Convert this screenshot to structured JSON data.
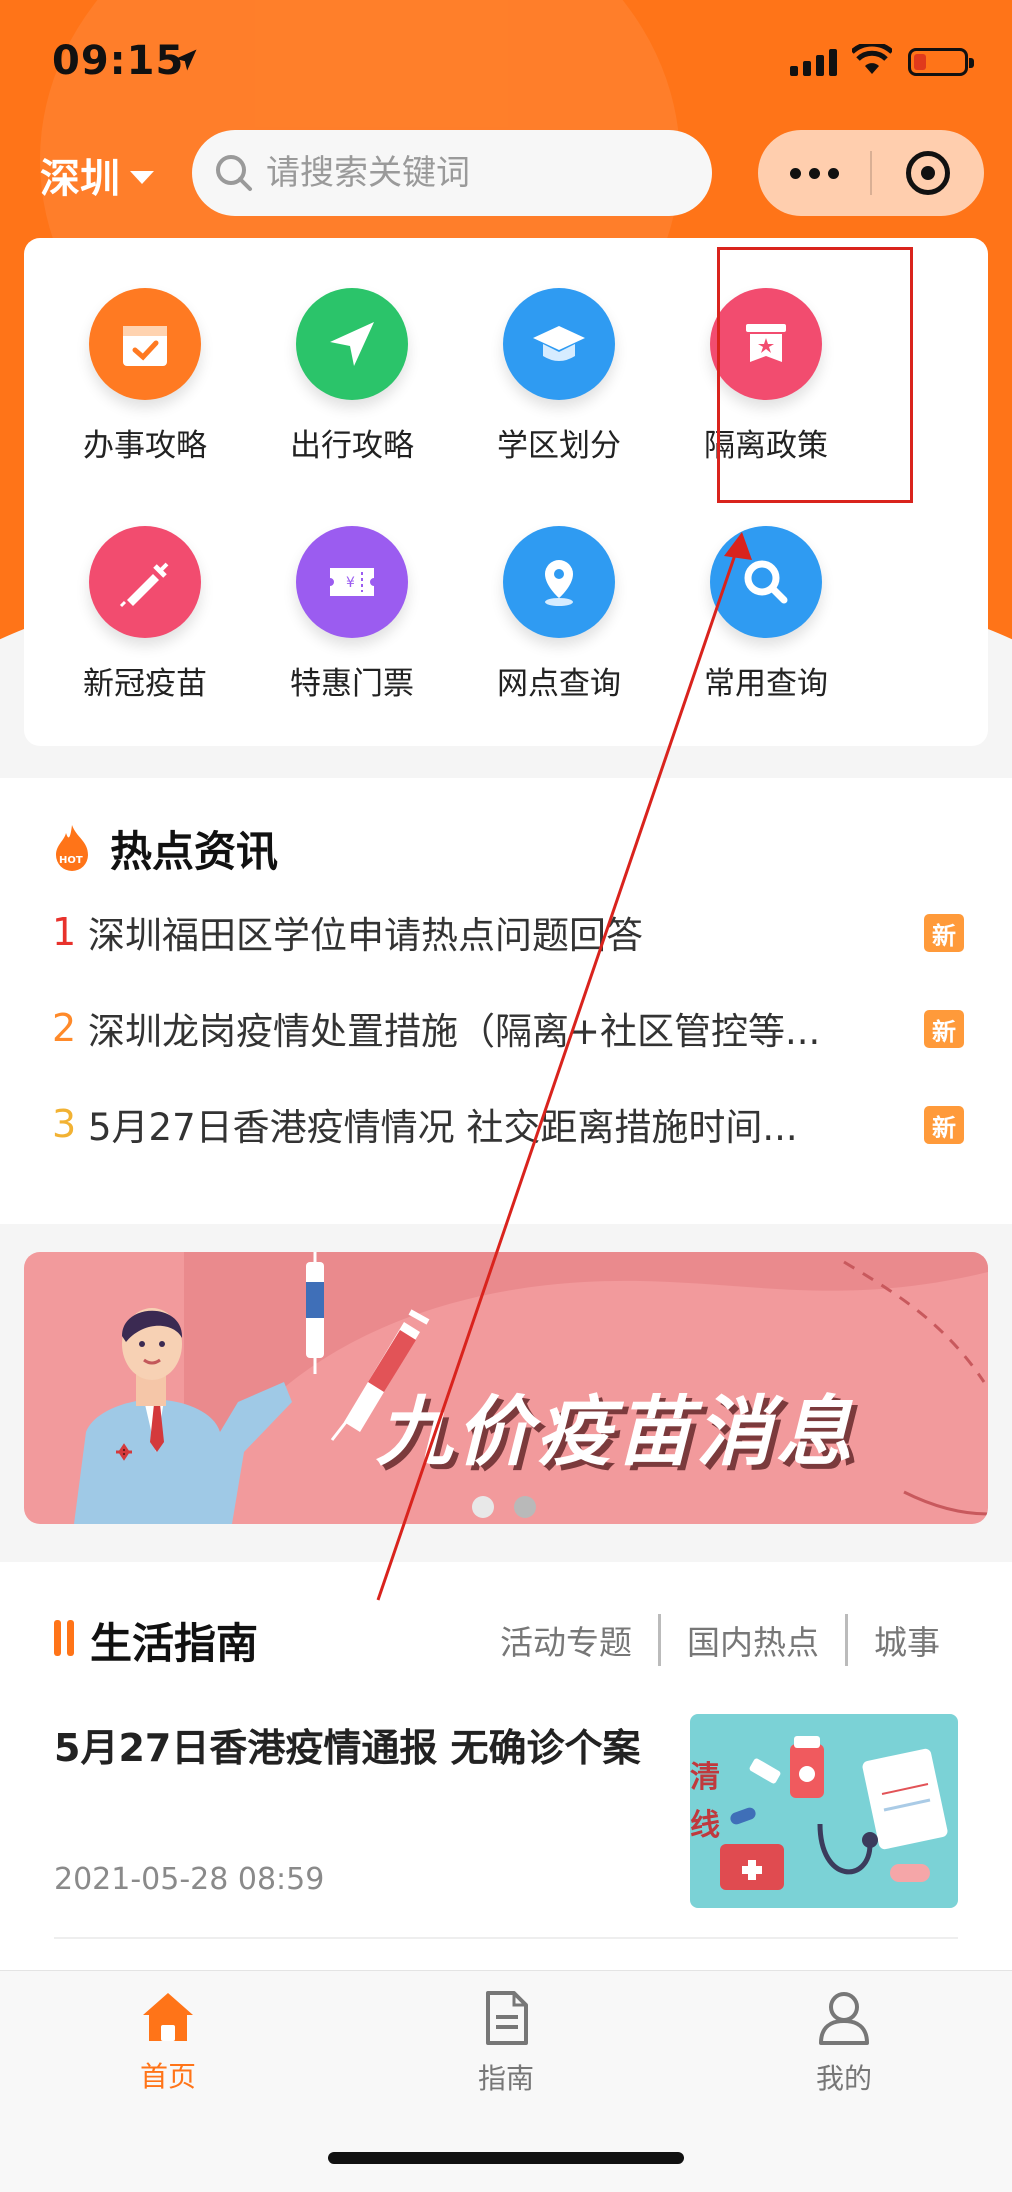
{
  "status_bar": {
    "time": "09:15"
  },
  "header": {
    "city": "深圳",
    "search_placeholder": "请搜索关键词"
  },
  "services": [
    {
      "label": "办事攻略",
      "icon": "calendar-check-icon",
      "color": "#ff7a22"
    },
    {
      "label": "出行攻略",
      "icon": "paper-plane-icon",
      "color": "#2bc46a"
    },
    {
      "label": "学区划分",
      "icon": "graduation-cap-icon",
      "color": "#2f9bf2"
    },
    {
      "label": "隔离政策",
      "icon": "policy-badge-icon",
      "color": "#f24c6f"
    },
    {
      "label": "新冠疫苗",
      "icon": "syringe-icon",
      "color": "#f24c6f"
    },
    {
      "label": "特惠门票",
      "icon": "ticket-icon",
      "color": "#9b5cf0"
    },
    {
      "label": "网点查询",
      "icon": "location-pin-icon",
      "color": "#2f9bf2"
    },
    {
      "label": "常用查询",
      "icon": "magnifier-icon",
      "color": "#2f9bf2"
    }
  ],
  "hot_news": {
    "title": "热点资讯",
    "hot_icon_text": "HOT",
    "items": [
      {
        "num": "1",
        "text": "深圳福田区学位申请热点问题回答",
        "badge": "新",
        "num_color": "#e8322c"
      },
      {
        "num": "2",
        "text": "深圳龙岗疫情处置措施（隔离+社区管控等...",
        "badge": "新",
        "num_color": "#ff8a2a"
      },
      {
        "num": "3",
        "text": "5月27日香港疫情情况 社交距离措施时间...",
        "badge": "新",
        "num_color": "#f2b233"
      }
    ]
  },
  "banner": {
    "title": "九价疫苗消息",
    "page_count": 2,
    "active_index": 0
  },
  "life_guide": {
    "title": "生活指南",
    "tabs": [
      "活动专题",
      "国内热点",
      "城事"
    ],
    "article": {
      "title": "5月27日香港疫情通报 无确诊个案",
      "date": "2021-05-28 08:59",
      "thumb_text": "清\n线"
    }
  },
  "tabbar": [
    {
      "label": "首页",
      "icon": "home-icon",
      "active": true
    },
    {
      "label": "指南",
      "icon": "document-icon",
      "active": false
    },
    {
      "label": "我的",
      "icon": "user-icon",
      "active": false
    }
  ],
  "colors": {
    "brand": "#ff7418",
    "highlight": "#d9231d"
  }
}
